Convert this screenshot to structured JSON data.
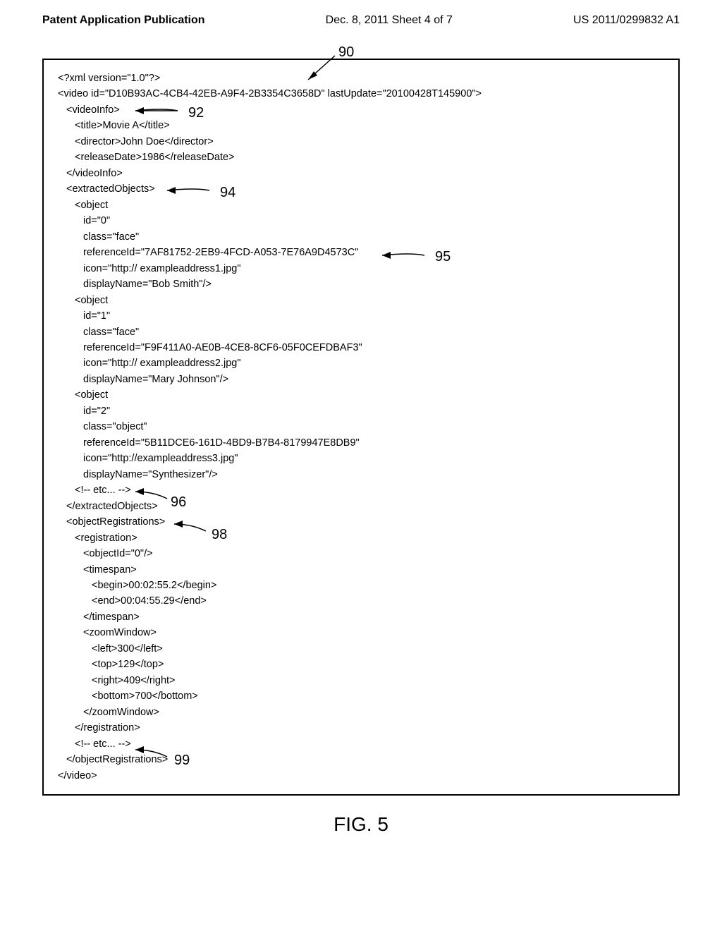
{
  "header": {
    "left": "Patent Application Publication",
    "center": "Dec. 8, 2011  Sheet 4 of 7",
    "right": "US 2011/0299832 A1"
  },
  "annotations": {
    "ref90": "90",
    "ref92": "92",
    "ref94": "94",
    "ref95": "95",
    "ref96": "96",
    "ref98": "98",
    "ref99": "99"
  },
  "xml": {
    "l1": "<?xml version=\"1.0\"?>",
    "l2": "<video id=\"D10B93AC-4CB4-42EB-A9F4-2B3354C3658D\" lastUpdate=\"20100428T145900\">",
    "l3": "<videoInfo>",
    "l4": "<title>Movie A</title>",
    "l5": "<director>John Doe</director>",
    "l6": "<releaseDate>1986</releaseDate>",
    "l7": "</videoInfo>",
    "l8": "<extractedObjects>",
    "l9": "<object",
    "l10": "id=\"0\"",
    "l11": "class=\"face\"",
    "l12": "referenceId=\"7AF81752-2EB9-4FCD-A053-7E76A9D4573C\"",
    "l13": "icon=\"http:// exampleaddress1.jpg\"",
    "l14": "displayName=\"Bob Smith\"/>",
    "l15": "<object",
    "l16": "id=\"1\"",
    "l17": "class=\"face\"",
    "l18": "referenceId=\"F9F411A0-AE0B-4CE8-8CF6-05F0CEFDBAF3\"",
    "l19": "icon=\"http:// exampleaddress2.jpg\"",
    "l20": "displayName=\"Mary Johnson\"/>",
    "l21": "<object",
    "l22": "id=\"2\"",
    "l23": "class=\"object\"",
    "l24": "referenceId=\"5B11DCE6-161D-4BD9-B7B4-8179947E8DB9\"",
    "l25": "icon=\"http://exampleaddress3.jpg\"",
    "l26": "displayName=\"Synthesizer\"/>",
    "l27": "<!-- etc... -->",
    "l28": "</extractedObjects>",
    "l29": "<objectRegistrations>",
    "l30": "<registration>",
    "l31": "<objectId=\"0\"/>",
    "l32": "<timespan>",
    "l33": "<begin>00:02:55.2</begin>",
    "l34": "<end>00:04:55.29</end>",
    "l35": "</timespan>",
    "l36": "<zoomWindow>",
    "l37": "<left>300</left>",
    "l38": "<top>129</top>",
    "l39": "<right>409</right>",
    "l40": "<bottom>700</bottom>",
    "l41": "</zoomWindow>",
    "l42": "</registration>",
    "l43": "<!-- etc... -->",
    "l44": "</objectRegistrations>",
    "l45": "</video>"
  },
  "figure_caption": "FIG. 5"
}
